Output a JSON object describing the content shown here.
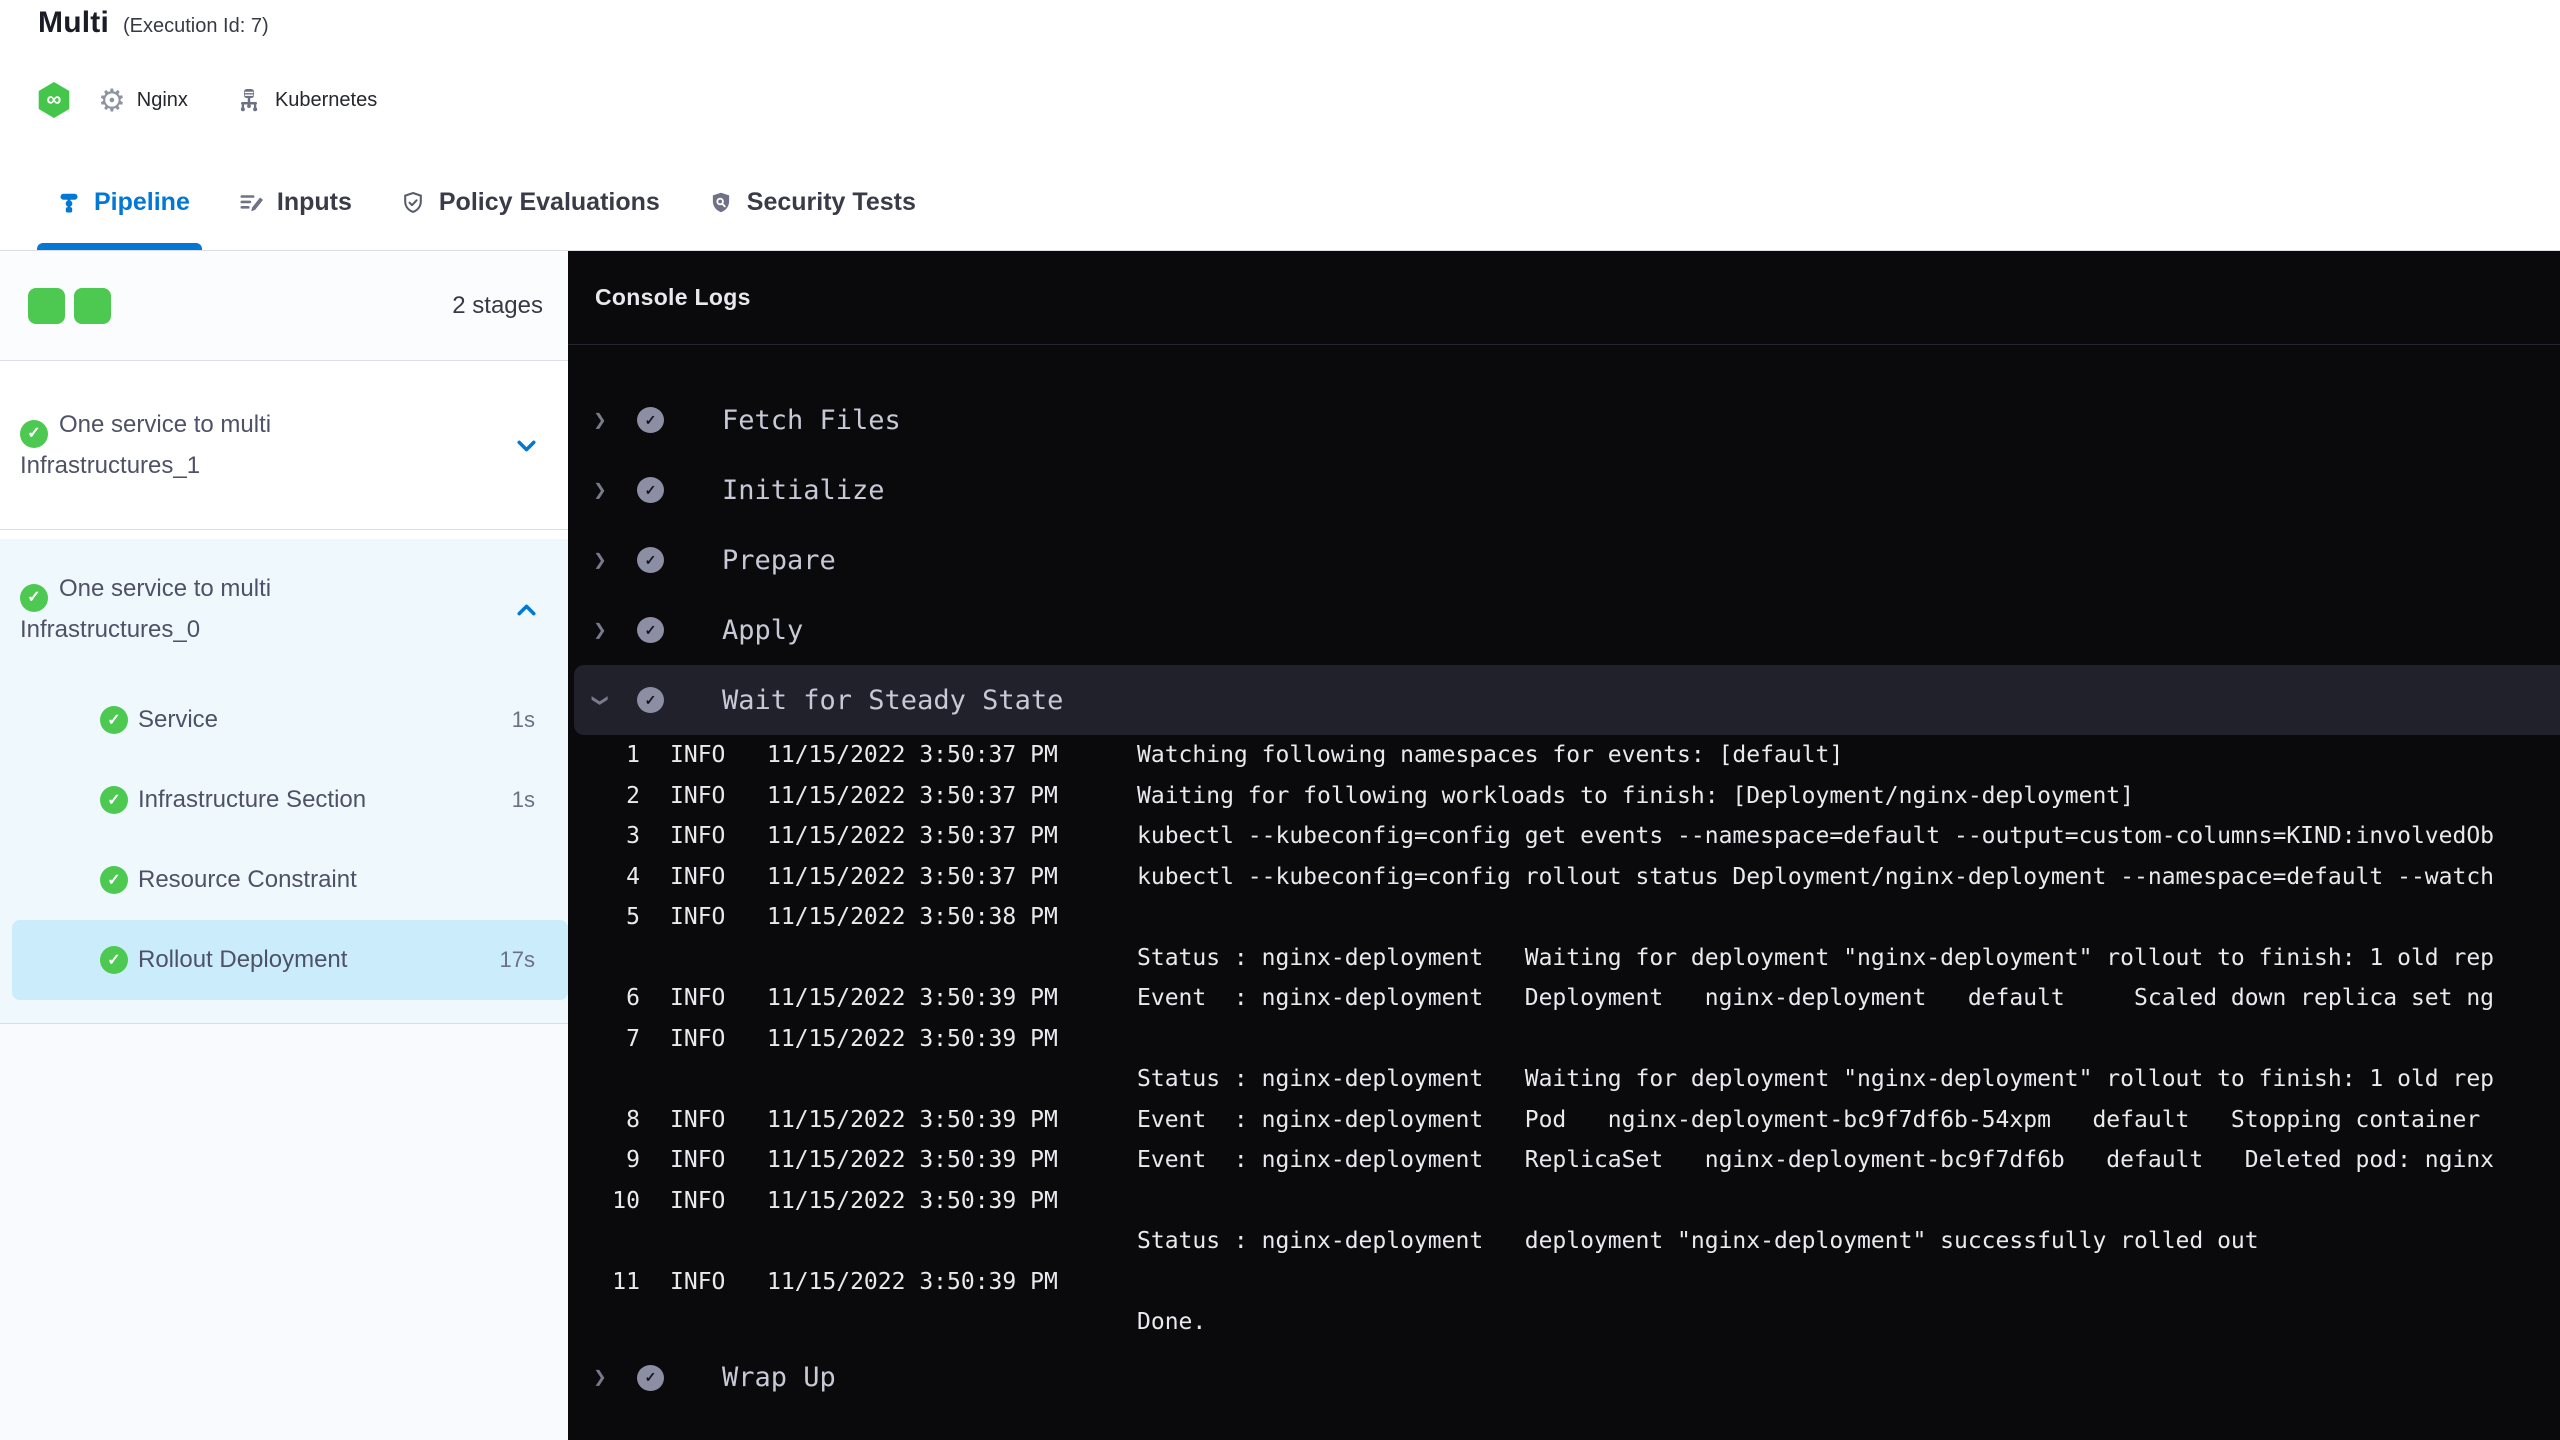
{
  "header": {
    "title": "Multi",
    "subtitle": "(Execution Id: 7)",
    "service_label": "Nginx",
    "infra_label": "Kubernetes"
  },
  "tabs": [
    {
      "label": "Pipeline",
      "icon": "pipeline-icon",
      "active": true
    },
    {
      "label": "Inputs",
      "icon": "inputs-icon",
      "active": false
    },
    {
      "label": "Policy Evaluations",
      "icon": "policy-icon",
      "active": false
    },
    {
      "label": "Security Tests",
      "icon": "security-icon",
      "active": false
    }
  ],
  "sidebar": {
    "stages_count": "2 stages",
    "stage_indicator_count": 2,
    "stages": [
      {
        "name": "One service to multi Infrastructures_1",
        "status": "success",
        "expanded": false,
        "steps": []
      },
      {
        "name": "One service to multi Infrastructures_0",
        "status": "success",
        "expanded": true,
        "steps": [
          {
            "name": "Service",
            "duration": "1s",
            "status": "success",
            "selected": false
          },
          {
            "name": "Infrastructure Section",
            "duration": "1s",
            "status": "success",
            "selected": false
          },
          {
            "name": "Resource Constraint",
            "duration": "",
            "status": "success",
            "selected": false
          },
          {
            "name": "Rollout Deployment",
            "duration": "17s",
            "status": "success",
            "selected": true
          }
        ]
      }
    ]
  },
  "console": {
    "title": "Console Logs",
    "steps": [
      {
        "label": "Fetch Files",
        "status": "success",
        "expanded": false
      },
      {
        "label": "Initialize",
        "status": "success",
        "expanded": false
      },
      {
        "label": "Prepare",
        "status": "success",
        "expanded": false
      },
      {
        "label": "Apply",
        "status": "success",
        "expanded": false
      },
      {
        "label": "Wait for Steady State",
        "status": "success",
        "expanded": true
      },
      {
        "label": "Wrap Up",
        "status": "success",
        "expanded": false
      }
    ],
    "logs": [
      {
        "num": "1",
        "level": "INFO",
        "time": "11/15/2022 3:50:37 PM",
        "msg": "Watching following namespaces for events: [default]"
      },
      {
        "num": "2",
        "level": "INFO",
        "time": "11/15/2022 3:50:37 PM",
        "msg": "Waiting for following workloads to finish: [Deployment/nginx-deployment]"
      },
      {
        "num": "3",
        "level": "INFO",
        "time": "11/15/2022 3:50:37 PM",
        "msg": "kubectl --kubeconfig=config get events --namespace=default --output=custom-columns=KIND:involvedOb"
      },
      {
        "num": "4",
        "level": "INFO",
        "time": "11/15/2022 3:50:37 PM",
        "msg": "kubectl --kubeconfig=config rollout status Deployment/nginx-deployment --namespace=default --watch"
      },
      {
        "num": "5",
        "level": "INFO",
        "time": "11/15/2022 3:50:38 PM",
        "msg": ""
      },
      {
        "num": "",
        "level": "",
        "time": "",
        "msg": "Status : nginx-deployment   Waiting for deployment \"nginx-deployment\" rollout to finish: 1 old rep"
      },
      {
        "num": "6",
        "level": "INFO",
        "time": "11/15/2022 3:50:39 PM",
        "msg": "Event  : nginx-deployment   Deployment   nginx-deployment   default     Scaled down replica set ng"
      },
      {
        "num": "7",
        "level": "INFO",
        "time": "11/15/2022 3:50:39 PM",
        "msg": ""
      },
      {
        "num": "",
        "level": "",
        "time": "",
        "msg": "Status : nginx-deployment   Waiting for deployment \"nginx-deployment\" rollout to finish: 1 old rep"
      },
      {
        "num": "8",
        "level": "INFO",
        "time": "11/15/2022 3:50:39 PM",
        "msg": "Event  : nginx-deployment   Pod   nginx-deployment-bc9f7df6b-54xpm   default   Stopping container"
      },
      {
        "num": "9",
        "level": "INFO",
        "time": "11/15/2022 3:50:39 PM",
        "msg": "Event  : nginx-deployment   ReplicaSet   nginx-deployment-bc9f7df6b   default   Deleted pod: nginx"
      },
      {
        "num": "10",
        "level": "INFO",
        "time": "11/15/2022 3:50:39 PM",
        "msg": ""
      },
      {
        "num": "",
        "level": "",
        "time": "",
        "msg": "Status : nginx-deployment   deployment \"nginx-deployment\" successfully rolled out"
      },
      {
        "num": "11",
        "level": "INFO",
        "time": "11/15/2022 3:50:39 PM",
        "msg": ""
      },
      {
        "num": "",
        "level": "",
        "time": "",
        "msg": "Done."
      }
    ]
  },
  "colors": {
    "accent": "#0278D5",
    "success": "#4DC952",
    "hex_green": "#43C64A",
    "console_bg": "#0A0A0C",
    "console_row": "#20212B",
    "console_text": "#E9E9EF",
    "sidebar_section": "#EFF8FD",
    "sidebar_selected": "#CBEDFB",
    "text_dark": "#1C1C26",
    "text_gray": "#383946"
  }
}
